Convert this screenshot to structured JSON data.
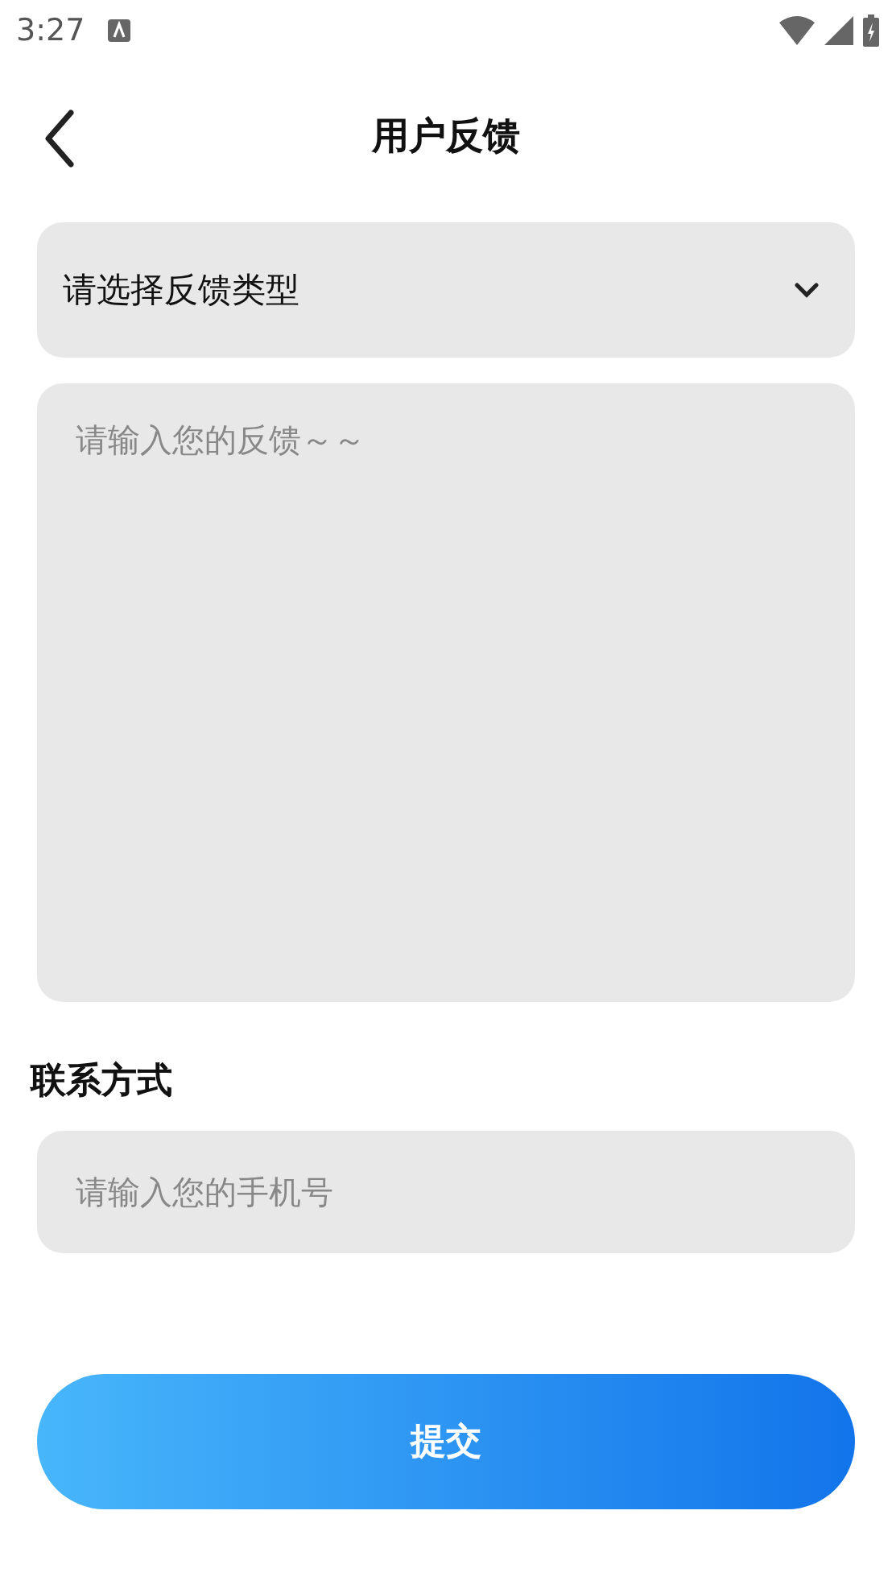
{
  "status_bar": {
    "time": "3:27"
  },
  "header": {
    "title": "用户反馈"
  },
  "feedback_type": {
    "value": "请选择反馈类型"
  },
  "feedback": {
    "placeholder": "请输入您的反馈～～"
  },
  "contact": {
    "label": "联系方式",
    "placeholder": "请输入您的手机号"
  },
  "submit": {
    "label": "提交"
  }
}
